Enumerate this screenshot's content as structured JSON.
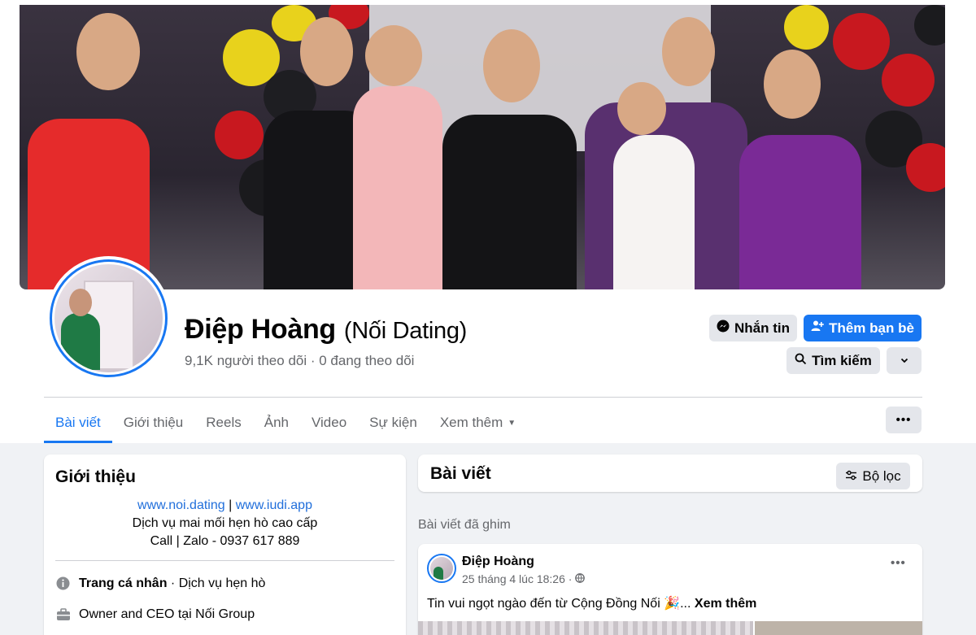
{
  "profile": {
    "name": "Điệp Hoàng",
    "alternate_name": "(Nối Dating)",
    "followers_text": "9,1K người theo dõi · 0 đang theo dõi"
  },
  "actions": {
    "message_label": "Nhắn tin",
    "add_friend_label": "Thêm bạn bè",
    "search_label": "Tìm kiếm",
    "more_icon": "chevron-down-icon"
  },
  "tabs": [
    {
      "label": "Bài viết",
      "active": true
    },
    {
      "label": "Giới thiệu"
    },
    {
      "label": "Reels"
    },
    {
      "label": "Ảnh"
    },
    {
      "label": "Video"
    },
    {
      "label": "Sự kiện"
    },
    {
      "label": "Xem thêm"
    }
  ],
  "intro": {
    "title": "Giới thiệu",
    "link1": "www.noi.dating",
    "separator": "|",
    "link2": "www.iudi.app",
    "bio_line2": "Dịch vụ mai mối hẹn hò cao cấp",
    "bio_line3": "Call | Zalo - 0937 617 889",
    "page_type_bold": "Trang cá nhân",
    "page_type_rest": " · Dịch vụ hẹn hò",
    "work": "Owner and CEO tại Nối Group"
  },
  "posts": {
    "title": "Bài viết",
    "filter_label": "Bộ lọc",
    "pinned_label": "Bài viết đã ghim",
    "pinned_post": {
      "author": "Điệp Hoàng",
      "time": "25 tháng 4 lúc 18:26 ·",
      "text": "Tin vui ngọt ngào đến từ Cộng Đồng Nối 🎉...",
      "see_more": "Xem thêm"
    }
  },
  "colors": {
    "accent": "#1877f2",
    "background": "#f0f2f5",
    "secondary_text": "#65676b"
  }
}
